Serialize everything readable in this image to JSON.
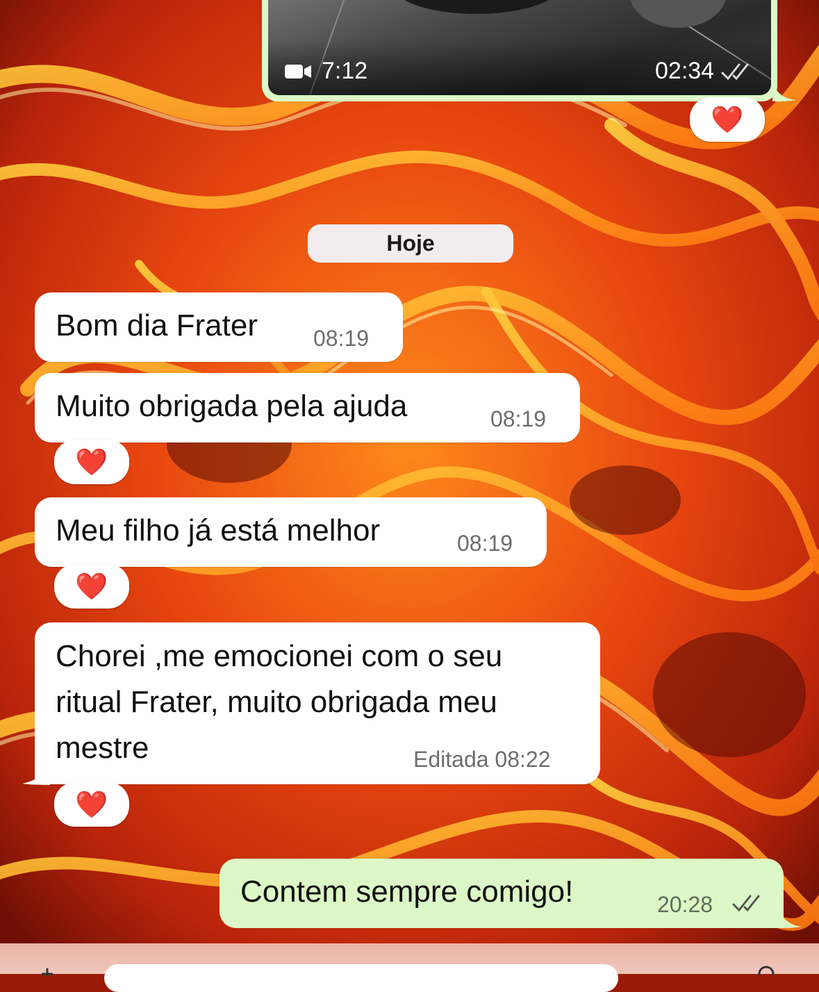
{
  "chat": {
    "video_message": {
      "duration": "7:12",
      "time": "02:34",
      "reaction": "❤️",
      "read_icon": "double-check-icon",
      "camera_icon": "video-camera-icon"
    },
    "date_separator": "Hoje",
    "messages": [
      {
        "text": "Bom dia Frater",
        "time": "08:19"
      },
      {
        "text": "Muito obrigada pela ajuda",
        "time": "08:19",
        "reaction": "❤️"
      },
      {
        "text": "Meu filho já está melhor",
        "time": "08:19",
        "reaction": "❤️"
      },
      {
        "lines": [
          "Chorei ,me emocionei com o seu",
          "ritual Frater, muito obrigada meu",
          "mestre"
        ],
        "time": "Editada 08:22",
        "reaction": "❤️"
      }
    ],
    "outgoing_reply": {
      "text": "Contem sempre comigo!",
      "time": "20:28",
      "read_icon": "double-check-icon"
    }
  },
  "colors": {
    "outgoing_bubble": "#dcf8c6",
    "incoming_bubble": "#ffffff",
    "reaction_heart": "#e01b24",
    "read_check": "#555555"
  }
}
